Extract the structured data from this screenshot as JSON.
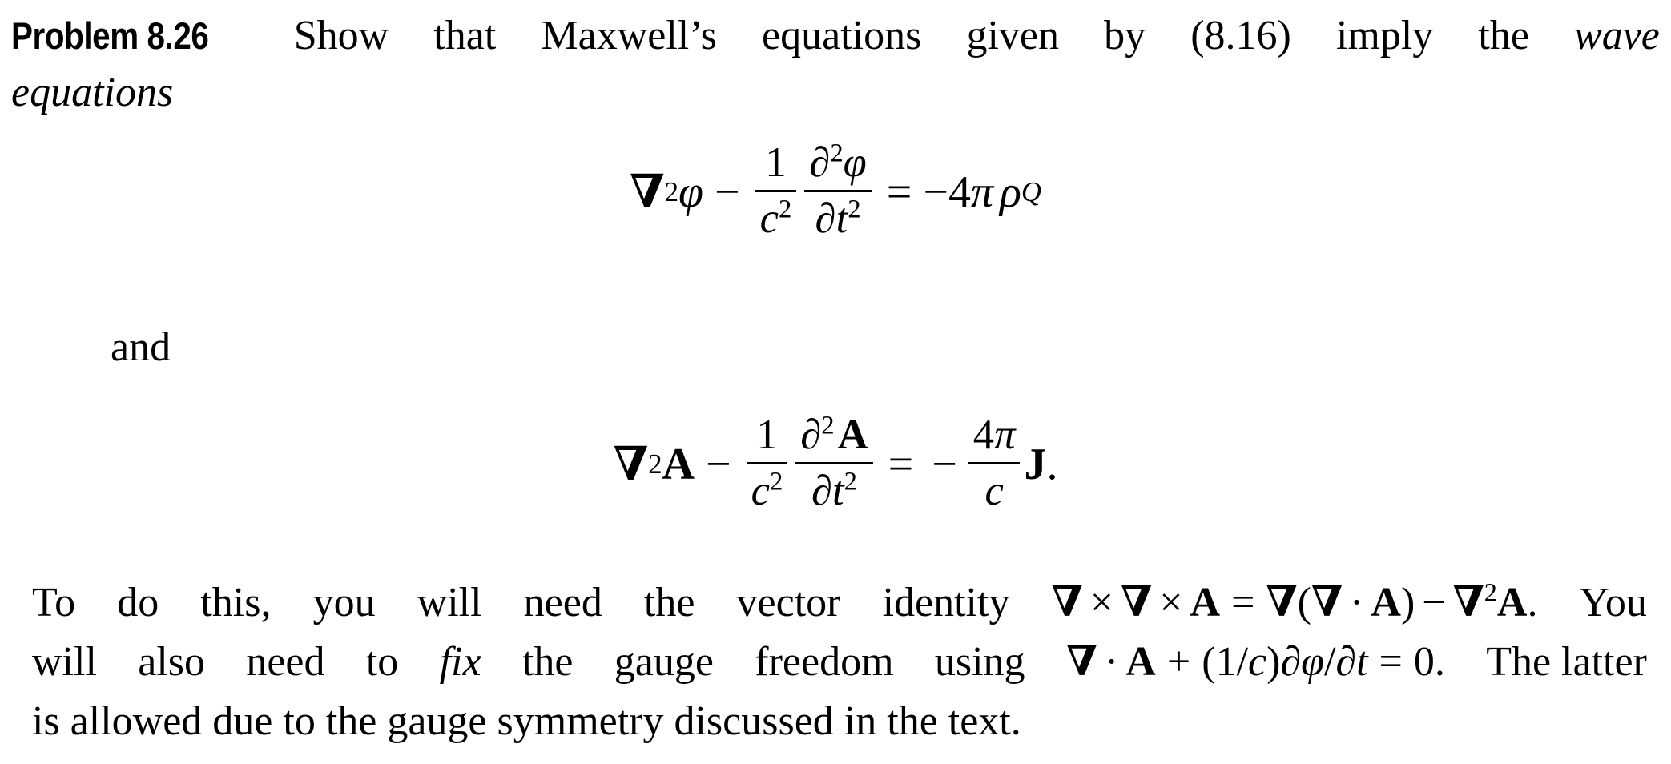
{
  "document": {
    "background_color": "#ffffff",
    "text_color": "#000000",
    "problem": {
      "label": "Problem 8.26",
      "statement_line_1": [
        "Show",
        "that",
        "Maxwell’s",
        "equations",
        "given",
        "by",
        "(8.16)",
        "imply",
        "the"
      ],
      "statement_line_1_last_italic": "wave",
      "statement_line_2_italic": "equations"
    },
    "connector": "and",
    "equations": [
      {
        "id": "wave-equation-scalar-potential",
        "latex": "\\nabla^2 \\phi - \\frac{1}{c^2}\\frac{\\partial^2 \\phi}{\\partial t^2} = -4\\pi\\rho_Q",
        "plain": "∇2φ − (1/c²)(∂²φ/∂t²) = −4πρ_Q",
        "parts": {
          "nabla": "∇",
          "nabla_exp": "2",
          "phi": "φ",
          "minus": "−",
          "frac1_num": "1",
          "frac1_den_base": "c",
          "frac1_den_exp": "2",
          "frac2_num_partial": "∂",
          "frac2_num_exp": "2",
          "frac2_num_var": "φ",
          "frac2_den_partial": "∂",
          "frac2_den_base": "t",
          "frac2_den_exp": "2",
          "equals": "=",
          "rhs_sign": "−",
          "rhs_four": "4",
          "rhs_pi": "π",
          "rhs_rho": "ρ",
          "rhs_rho_sub": "Q"
        }
      },
      {
        "id": "wave-equation-vector-potential",
        "latex": "\\nabla^2 \\mathbf{A} - \\frac{1}{c^2}\\frac{\\partial^2 \\mathbf{A}}{\\partial t^2} = -\\frac{4\\pi}{c}\\mathbf{J}.",
        "plain": "∇2A − (1/c²)(∂²A/∂t²) = −(4π/c)J.",
        "parts": {
          "nabla": "∇",
          "nabla_exp": "2",
          "vec_a": "A",
          "minus": "−",
          "frac1_num": "1",
          "frac1_den_base": "c",
          "frac1_den_exp": "2",
          "frac2_num_partial": "∂",
          "frac2_num_exp": "2",
          "frac2_num_var": "A",
          "frac2_den_partial": "∂",
          "frac2_den_base": "t",
          "frac2_den_exp": "2",
          "equals": "=",
          "rhs_sign": "−",
          "rhs_num_four": "4",
          "rhs_num_pi": "π",
          "rhs_den_c": "c",
          "rhs_vec_j": "J",
          "period": "."
        }
      }
    ],
    "paragraph": {
      "line_1": {
        "words": [
          "To",
          "do",
          "this,",
          "you",
          "will",
          "need",
          "the",
          "vector",
          "identity"
        ],
        "math": {
          "nabla": "∇",
          "cross": "×",
          "vec_a": "A",
          "equals": "=",
          "open_paren": "(",
          "dot": "·",
          "close_paren": ")",
          "minus": "−",
          "exp_two": "2",
          "period": "."
        },
        "trailing_word": "You"
      },
      "line_2": {
        "words_before": [
          "will",
          "also",
          "need",
          "to"
        ],
        "italic_word": "fix",
        "words_after": [
          "the",
          "gauge",
          "freedom",
          "using"
        ],
        "math": {
          "nabla": "∇",
          "dot": "·",
          "vec_a": "A",
          "plus": "+",
          "open_paren": "(",
          "one": "1",
          "slash": "/",
          "c": "c",
          "close_paren": ")",
          "partial": "∂",
          "phi": "φ",
          "slash2": "/",
          "partial2": "∂",
          "t": "t",
          "equals": "=",
          "zero": "0",
          "period": "."
        },
        "trailing_words": "The latter"
      },
      "line_3": "is allowed due to the gauge symmetry discussed in the text."
    }
  }
}
